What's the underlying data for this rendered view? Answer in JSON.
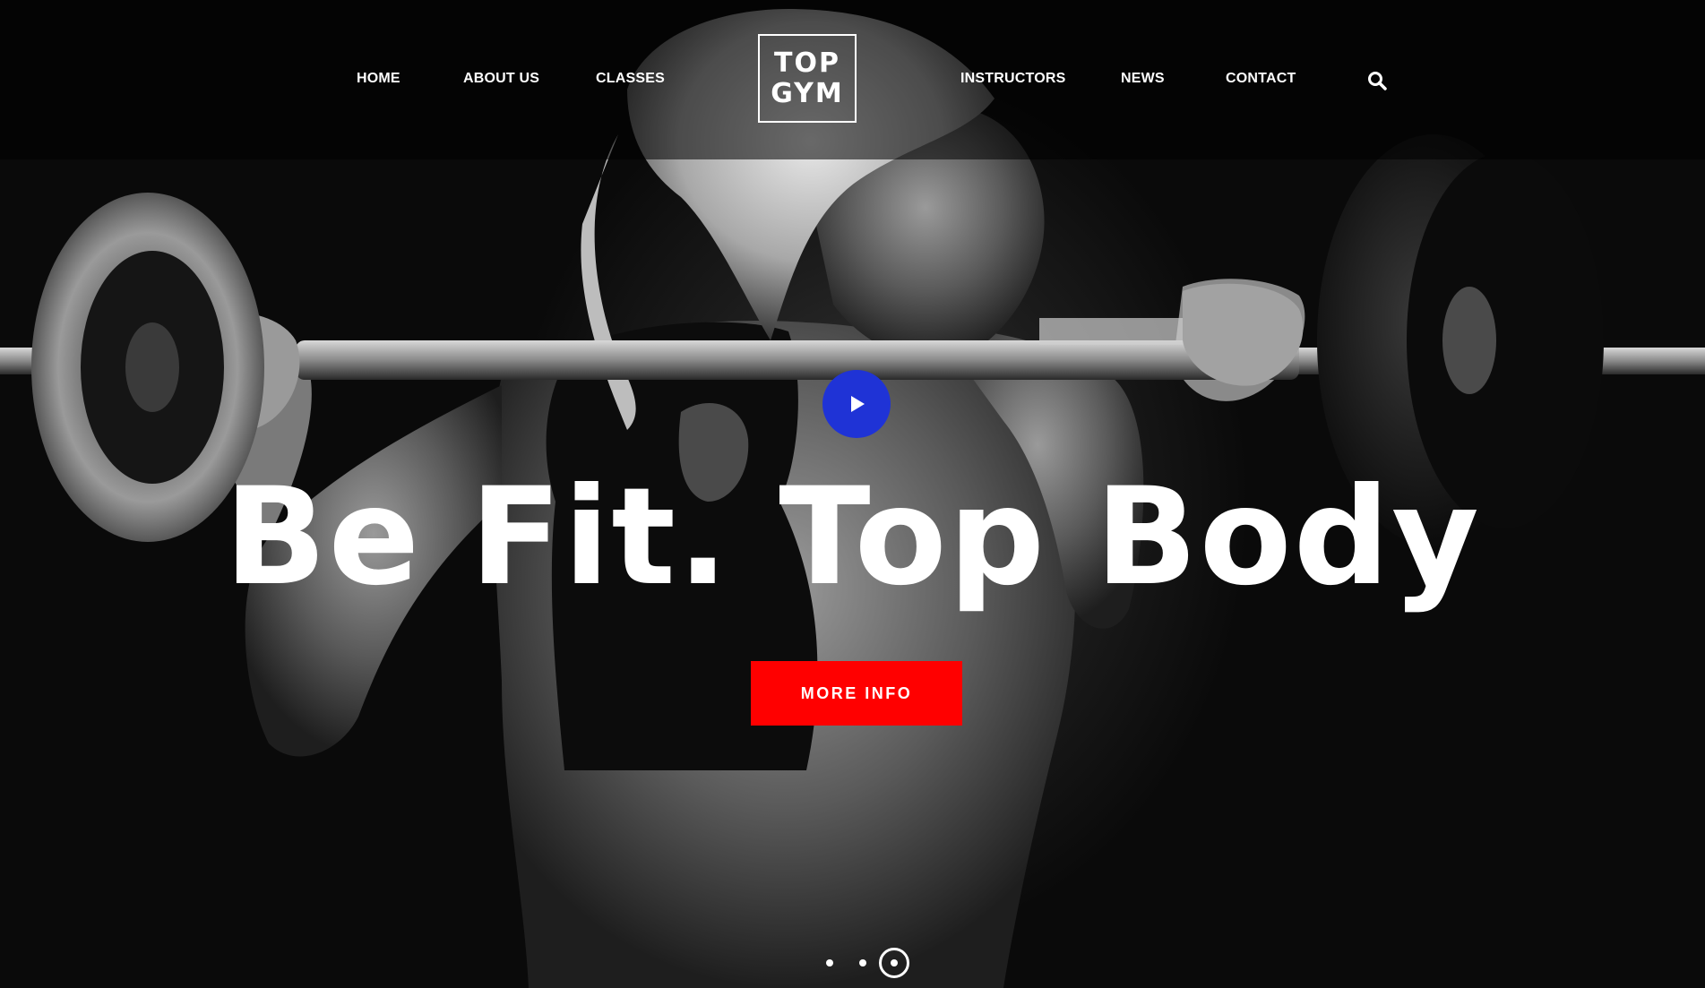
{
  "nav": {
    "left": [
      "HOME",
      "ABOUT US",
      "CLASSES"
    ],
    "right": [
      "INSTRUCTORS",
      "NEWS",
      "CONTACT"
    ],
    "search_icon": "search-icon"
  },
  "logo": {
    "line1": "TOP",
    "line2": "GYM"
  },
  "hero": {
    "title": "Be Fit. Top Body",
    "button_label": "MORE INFO",
    "play_icon": "play-icon",
    "background": "black-and-white photo of a woman lifting a barbell on her shoulders"
  },
  "slider": {
    "slide_count": 3,
    "active_slide": 3
  },
  "colors": {
    "accent_red": "#ff0000",
    "play_blue": "#1f33d6",
    "text": "#ffffff",
    "background": "#000000"
  }
}
